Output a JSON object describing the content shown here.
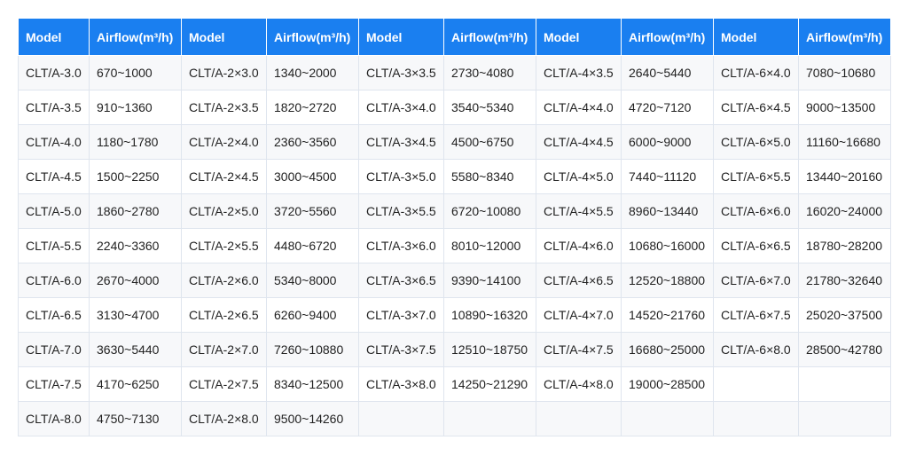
{
  "table": {
    "headers": [
      "Model",
      "Airflow(m³/h)",
      "Model",
      "Airflow(m³/h)",
      "Model",
      "Airflow(m³/h)",
      "Model",
      "Airflow(m³/h)",
      "Model",
      "Airflow(m³/h)"
    ],
    "rows": [
      [
        "CLT/A-3.0",
        "670~1000",
        "CLT/A-2×3.0",
        "1340~2000",
        "CLT/A-3×3.5",
        "2730~4080",
        "CLT/A-4×3.5",
        "2640~5440",
        "CLT/A-6×4.0",
        "7080~10680"
      ],
      [
        "CLT/A-3.5",
        "910~1360",
        "CLT/A-2×3.5",
        "1820~2720",
        "CLT/A-3×4.0",
        "3540~5340",
        "CLT/A-4×4.0",
        "4720~7120",
        "CLT/A-6×4.5",
        "9000~13500"
      ],
      [
        "CLT/A-4.0",
        "1180~1780",
        "CLT/A-2×4.0",
        "2360~3560",
        "CLT/A-3×4.5",
        "4500~6750",
        "CLT/A-4×4.5",
        "6000~9000",
        "CLT/A-6×5.0",
        "11160~16680"
      ],
      [
        "CLT/A-4.5",
        "1500~2250",
        "CLT/A-2×4.5",
        "3000~4500",
        "CLT/A-3×5.0",
        "5580~8340",
        "CLT/A-4×5.0",
        "7440~11120",
        "CLT/A-6×5.5",
        "13440~20160"
      ],
      [
        "CLT/A-5.0",
        "1860~2780",
        "CLT/A-2×5.0",
        "3720~5560",
        "CLT/A-3×5.5",
        "6720~10080",
        "CLT/A-4×5.5",
        "8960~13440",
        "CLT/A-6×6.0",
        "16020~24000"
      ],
      [
        "CLT/A-5.5",
        "2240~3360",
        "CLT/A-2×5.5",
        "4480~6720",
        "CLT/A-3×6.0",
        "8010~12000",
        "CLT/A-4×6.0",
        "10680~16000",
        "CLT/A-6×6.5",
        "18780~28200"
      ],
      [
        "CLT/A-6.0",
        "2670~4000",
        "CLT/A-2×6.0",
        "5340~8000",
        "CLT/A-3×6.5",
        "9390~14100",
        "CLT/A-4×6.5",
        "12520~18800",
        "CLT/A-6×7.0",
        "21780~32640"
      ],
      [
        "CLT/A-6.5",
        "3130~4700",
        "CLT/A-2×6.5",
        "6260~9400",
        "CLT/A-3×7.0",
        "10890~16320",
        "CLT/A-4×7.0",
        "14520~21760",
        "CLT/A-6×7.5",
        "25020~37500"
      ],
      [
        "CLT/A-7.0",
        "3630~5440",
        "CLT/A-2×7.0",
        "7260~10880",
        "CLT/A-3×7.5",
        "12510~18750",
        "CLT/A-4×7.5",
        "16680~25000",
        "CLT/A-6×8.0",
        "28500~42780"
      ],
      [
        "CLT/A-7.5",
        "4170~6250",
        "CLT/A-2×7.5",
        "8340~12500",
        "CLT/A-3×8.0",
        "14250~21290",
        "CLT/A-4×8.0",
        "19000~28500",
        "",
        ""
      ],
      [
        "CLT/A-8.0",
        "4750~7130",
        "CLT/A-2×8.0",
        "9500~14260",
        "",
        "",
        "",
        "",
        "",
        ""
      ]
    ]
  },
  "colors": {
    "header_bg": "#1a7ff0",
    "header_text": "#ffffff",
    "row_alt_bg": "#f7f8fa",
    "border": "#dfe5ee"
  }
}
